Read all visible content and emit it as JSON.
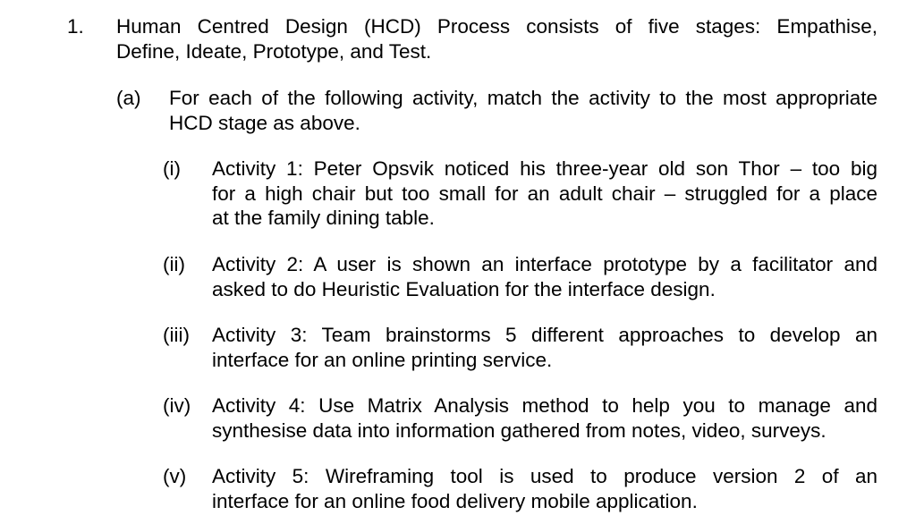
{
  "question": {
    "number": "1.",
    "lines": [
      "Human Centred Design (HCD) Process consists of five stages: Empathise,",
      "Define, Ideate, Prototype, and Test."
    ],
    "parts": [
      {
        "label": "(a)",
        "lines": [
          "For each of the following activity, match the activity to the most appropriate",
          "HCD stage as above."
        ],
        "subparts": [
          {
            "label": "(i)",
            "lines": [
              "Activity 1: Peter Opsvik noticed his three-year old son Thor – too big",
              "for a high chair but too small for an adult chair – struggled for a place",
              "at the family dining table."
            ]
          },
          {
            "label": "(ii)",
            "lines": [
              "Activity 2: A user is shown an interface prototype by a facilitator and",
              "asked to do Heuristic Evaluation for the interface design."
            ]
          },
          {
            "label": "(iii)",
            "lines": [
              "Activity 3: Team brainstorms 5 different approaches to develop an",
              "interface for an online printing service."
            ]
          },
          {
            "label": "(iv)",
            "lines": [
              "Activity 4: Use Matrix Analysis method to help you to manage and",
              "synthesise data into information gathered from notes, video, surveys."
            ]
          },
          {
            "label": "(v)",
            "lines": [
              "Activity 5: Wireframing tool is used to produce version 2 of an",
              "interface for an online food delivery mobile application."
            ]
          }
        ]
      }
    ]
  }
}
